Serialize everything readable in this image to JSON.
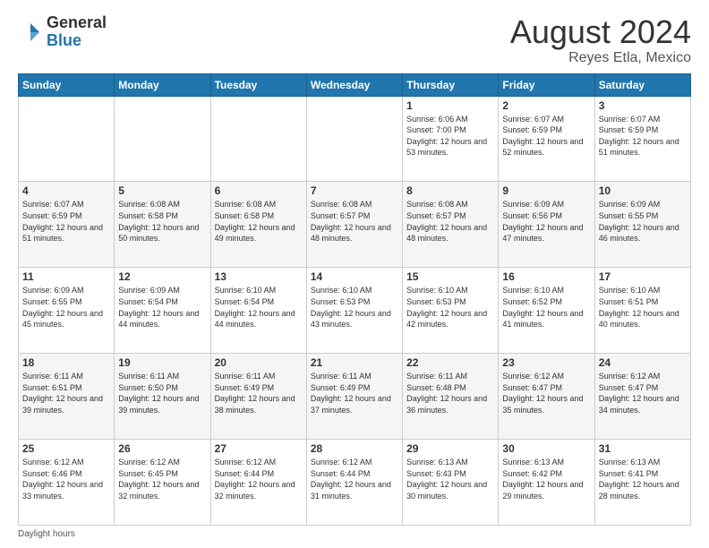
{
  "header": {
    "logo_general": "General",
    "logo_blue": "Blue",
    "title": "August 2024",
    "location": "Reyes Etla, Mexico"
  },
  "weekdays": [
    "Sunday",
    "Monday",
    "Tuesday",
    "Wednesday",
    "Thursday",
    "Friday",
    "Saturday"
  ],
  "footer_text": "Daylight hours",
  "weeks": [
    [
      {
        "day": "",
        "info": ""
      },
      {
        "day": "",
        "info": ""
      },
      {
        "day": "",
        "info": ""
      },
      {
        "day": "",
        "info": ""
      },
      {
        "day": "1",
        "info": "Sunrise: 6:06 AM\nSunset: 7:00 PM\nDaylight: 12 hours\nand 53 minutes."
      },
      {
        "day": "2",
        "info": "Sunrise: 6:07 AM\nSunset: 6:59 PM\nDaylight: 12 hours\nand 52 minutes."
      },
      {
        "day": "3",
        "info": "Sunrise: 6:07 AM\nSunset: 6:59 PM\nDaylight: 12 hours\nand 51 minutes."
      }
    ],
    [
      {
        "day": "4",
        "info": "Sunrise: 6:07 AM\nSunset: 6:59 PM\nDaylight: 12 hours\nand 51 minutes."
      },
      {
        "day": "5",
        "info": "Sunrise: 6:08 AM\nSunset: 6:58 PM\nDaylight: 12 hours\nand 50 minutes."
      },
      {
        "day": "6",
        "info": "Sunrise: 6:08 AM\nSunset: 6:58 PM\nDaylight: 12 hours\nand 49 minutes."
      },
      {
        "day": "7",
        "info": "Sunrise: 6:08 AM\nSunset: 6:57 PM\nDaylight: 12 hours\nand 48 minutes."
      },
      {
        "day": "8",
        "info": "Sunrise: 6:08 AM\nSunset: 6:57 PM\nDaylight: 12 hours\nand 48 minutes."
      },
      {
        "day": "9",
        "info": "Sunrise: 6:09 AM\nSunset: 6:56 PM\nDaylight: 12 hours\nand 47 minutes."
      },
      {
        "day": "10",
        "info": "Sunrise: 6:09 AM\nSunset: 6:55 PM\nDaylight: 12 hours\nand 46 minutes."
      }
    ],
    [
      {
        "day": "11",
        "info": "Sunrise: 6:09 AM\nSunset: 6:55 PM\nDaylight: 12 hours\nand 45 minutes."
      },
      {
        "day": "12",
        "info": "Sunrise: 6:09 AM\nSunset: 6:54 PM\nDaylight: 12 hours\nand 44 minutes."
      },
      {
        "day": "13",
        "info": "Sunrise: 6:10 AM\nSunset: 6:54 PM\nDaylight: 12 hours\nand 44 minutes."
      },
      {
        "day": "14",
        "info": "Sunrise: 6:10 AM\nSunset: 6:53 PM\nDaylight: 12 hours\nand 43 minutes."
      },
      {
        "day": "15",
        "info": "Sunrise: 6:10 AM\nSunset: 6:53 PM\nDaylight: 12 hours\nand 42 minutes."
      },
      {
        "day": "16",
        "info": "Sunrise: 6:10 AM\nSunset: 6:52 PM\nDaylight: 12 hours\nand 41 minutes."
      },
      {
        "day": "17",
        "info": "Sunrise: 6:10 AM\nSunset: 6:51 PM\nDaylight: 12 hours\nand 40 minutes."
      }
    ],
    [
      {
        "day": "18",
        "info": "Sunrise: 6:11 AM\nSunset: 6:51 PM\nDaylight: 12 hours\nand 39 minutes."
      },
      {
        "day": "19",
        "info": "Sunrise: 6:11 AM\nSunset: 6:50 PM\nDaylight: 12 hours\nand 39 minutes."
      },
      {
        "day": "20",
        "info": "Sunrise: 6:11 AM\nSunset: 6:49 PM\nDaylight: 12 hours\nand 38 minutes."
      },
      {
        "day": "21",
        "info": "Sunrise: 6:11 AM\nSunset: 6:49 PM\nDaylight: 12 hours\nand 37 minutes."
      },
      {
        "day": "22",
        "info": "Sunrise: 6:11 AM\nSunset: 6:48 PM\nDaylight: 12 hours\nand 36 minutes."
      },
      {
        "day": "23",
        "info": "Sunrise: 6:12 AM\nSunset: 6:47 PM\nDaylight: 12 hours\nand 35 minutes."
      },
      {
        "day": "24",
        "info": "Sunrise: 6:12 AM\nSunset: 6:47 PM\nDaylight: 12 hours\nand 34 minutes."
      }
    ],
    [
      {
        "day": "25",
        "info": "Sunrise: 6:12 AM\nSunset: 6:46 PM\nDaylight: 12 hours\nand 33 minutes."
      },
      {
        "day": "26",
        "info": "Sunrise: 6:12 AM\nSunset: 6:45 PM\nDaylight: 12 hours\nand 32 minutes."
      },
      {
        "day": "27",
        "info": "Sunrise: 6:12 AM\nSunset: 6:44 PM\nDaylight: 12 hours\nand 32 minutes."
      },
      {
        "day": "28",
        "info": "Sunrise: 6:12 AM\nSunset: 6:44 PM\nDaylight: 12 hours\nand 31 minutes."
      },
      {
        "day": "29",
        "info": "Sunrise: 6:13 AM\nSunset: 6:43 PM\nDaylight: 12 hours\nand 30 minutes."
      },
      {
        "day": "30",
        "info": "Sunrise: 6:13 AM\nSunset: 6:42 PM\nDaylight: 12 hours\nand 29 minutes."
      },
      {
        "day": "31",
        "info": "Sunrise: 6:13 AM\nSunset: 6:41 PM\nDaylight: 12 hours\nand 28 minutes."
      }
    ]
  ]
}
